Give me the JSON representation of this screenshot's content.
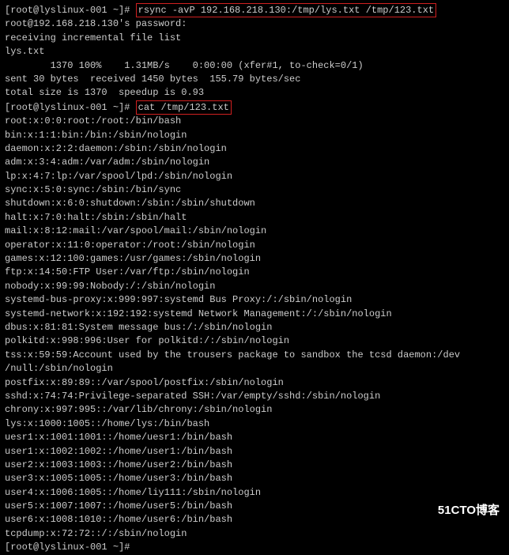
{
  "prompt1": "[root@lyslinux-001 ~]# ",
  "cmd1": "rsync -avP 192.168.218.130:/tmp/lys.txt /tmp/123.txt",
  "afterCmd1": [
    "root@192.168.218.130's password:",
    "receiving incremental file list",
    "lys.txt",
    "        1370 100%    1.31MB/s    0:00:00 (xfer#1, to-check=0/1)",
    "",
    "sent 30 bytes  received 1450 bytes  155.79 bytes/sec",
    "total size is 1370  speedup is 0.93"
  ],
  "prompt2": "[root@lyslinux-001 ~]# ",
  "cmd2": "cat /tmp/123.txt",
  "afterCmd2": [
    "root:x:0:0:root:/root:/bin/bash",
    "bin:x:1:1:bin:/bin:/sbin/nologin",
    "daemon:x:2:2:daemon:/sbin:/sbin/nologin",
    "adm:x:3:4:adm:/var/adm:/sbin/nologin",
    "lp:x:4:7:lp:/var/spool/lpd:/sbin/nologin",
    "sync:x:5:0:sync:/sbin:/bin/sync",
    "shutdown:x:6:0:shutdown:/sbin:/sbin/shutdown",
    "halt:x:7:0:halt:/sbin:/sbin/halt",
    "mail:x:8:12:mail:/var/spool/mail:/sbin/nologin",
    "operator:x:11:0:operator:/root:/sbin/nologin",
    "games:x:12:100:games:/usr/games:/sbin/nologin",
    "ftp:x:14:50:FTP User:/var/ftp:/sbin/nologin",
    "nobody:x:99:99:Nobody:/:/sbin/nologin",
    "systemd-bus-proxy:x:999:997:systemd Bus Proxy:/:/sbin/nologin",
    "systemd-network:x:192:192:systemd Network Management:/:/sbin/nologin",
    "dbus:x:81:81:System message bus:/:/sbin/nologin",
    "polkitd:x:998:996:User for polkitd:/:/sbin/nologin",
    "tss:x:59:59:Account used by the trousers package to sandbox the tcsd daemon:/dev",
    "/null:/sbin/nologin",
    "postfix:x:89:89::/var/spool/postfix:/sbin/nologin",
    "sshd:x:74:74:Privilege-separated SSH:/var/empty/sshd:/sbin/nologin",
    "chrony:x:997:995::/var/lib/chrony:/sbin/nologin",
    "lys:x:1000:1005::/home/lys:/bin/bash",
    "uesr1:x:1001:1001::/home/uesr1:/bin/bash",
    "user1:x:1002:1002::/home/user1:/bin/bash",
    "user2:x:1003:1003::/home/user2:/bin/bash",
    "user3:x:1005:1005::/home/user3:/bin/bash",
    "user4:x:1006:1005::/home/liy111:/sbin/nologin",
    "user5:x:1007:1007::/home/user5:/bin/bash",
    "user6:x:1008:1010::/home/user6:/bin/bash",
    "tcpdump:x:72:72::/:/sbin/nologin"
  ],
  "prompt3": "[root@lyslinux-001 ~]# ",
  "watermark": "51CTO博客"
}
